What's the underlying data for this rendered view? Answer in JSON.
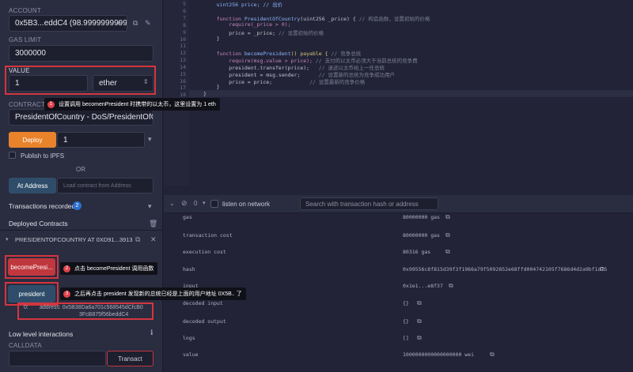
{
  "account": {
    "label": "ACCOUNT",
    "value": "0x5B3...eddC4 (98.99999999999"
  },
  "gas_limit": {
    "label": "GAS LIMIT",
    "value": "3000000"
  },
  "value": {
    "label": "VALUE",
    "amount": "1",
    "unit": "ether"
  },
  "contract": {
    "label": "CONTRACT",
    "selected": "PresidentOfCountry - DoS/PresidentOfCoun",
    "tip_num": "1",
    "tip_text": "设置调用 becomenPresident 时携带的以太币，这里设置为 1 eth"
  },
  "deploy": {
    "label": "Deploy",
    "arg": "1",
    "publish_label": "Publish to IPFS"
  },
  "or_label": "OR",
  "at_address": {
    "label": "At Address",
    "placeholder": "Load contract from Address"
  },
  "transactions": {
    "label": "Transactions recorded",
    "count": "2"
  },
  "deployed": {
    "label": "Deployed Contracts",
    "instance": "PRESIDENTOFCOUNTRY AT 0XD91...3913",
    "become_btn": "becomePresi...",
    "tip2_num": "2",
    "tip2_text": "点击 becomePresident 调用函数",
    "president_btn": "president",
    "tip3_num": "3",
    "tip3_text": "之后再点击 president 发现新的总统已经是上面的用户地址 0X5B.. 了",
    "result_index": "0:",
    "result_line1": "address: 0x5B38Da6a701c568545dCfcB0",
    "result_line2": "3FcB875f56beddC4"
  },
  "low_level": {
    "label": "Low level interactions",
    "calldata_label": "CALLDATA",
    "transact_label": "Transact"
  },
  "editor": {
    "line_numbers": [
      "5",
      "6",
      "7",
      "8",
      "9",
      "10",
      "11",
      "12",
      "13",
      "14",
      "15",
      "16",
      "17",
      "18"
    ],
    "line5": "    uint256 price; // 出价",
    "line7_a": "    function ",
    "line7_b": "PresidentOfCountry",
    "line7_c": "(uint256 _price) { ",
    "line7_d": "// 构造函数，设置初始的价格",
    "line8": "        require(_price > 0);",
    "line9_a": "        price = _price; ",
    "line9_b": "// 设置初始的价格",
    "line10": "    }",
    "line12_a": "    function ",
    "line12_b": "becomePresident",
    "line12_c": "() payable { ",
    "line12_d": "// 竞争总统",
    "line13_a": "        require(msg.value > price); ",
    "line13_b": "// 支付的以太币必须大于当前总统的竞争费",
    "line14_a": "        president.transfer(price);   ",
    "line14_b": "// 退还以太币给上一任总统",
    "line15_a": "        president = msg.sender;      ",
    "line15_b": "// 设置新的总统为竞争成功用户",
    "line16_a": "        price = price;            ",
    "line16_b": "// 设置最新的竞争价格",
    "line17": "    }",
    "line18": "}"
  },
  "terminal": {
    "count": "0",
    "listen_label": "listen on network",
    "search_placeholder": "Search with transaction hash or address",
    "rows": [
      {
        "key": "gas",
        "value": "80000000 gas"
      },
      {
        "key": "transaction cost",
        "value": "80000000 gas"
      },
      {
        "key": "execution cost",
        "value": "80316 gas"
      },
      {
        "key": "hash",
        "value": "0x99556c8f815d39f3f1966a79f5092852e68ffd004742105f7686d4d2a9bf1d75"
      },
      {
        "key": "input",
        "value": "0x1e1...e8f37"
      },
      {
        "key": "decoded input",
        "value": "{}"
      },
      {
        "key": "decoded output",
        "value": "{}"
      },
      {
        "key": "logs",
        "value": "[]"
      },
      {
        "key": "value",
        "value": "1000000000000000000 wei"
      }
    ]
  }
}
